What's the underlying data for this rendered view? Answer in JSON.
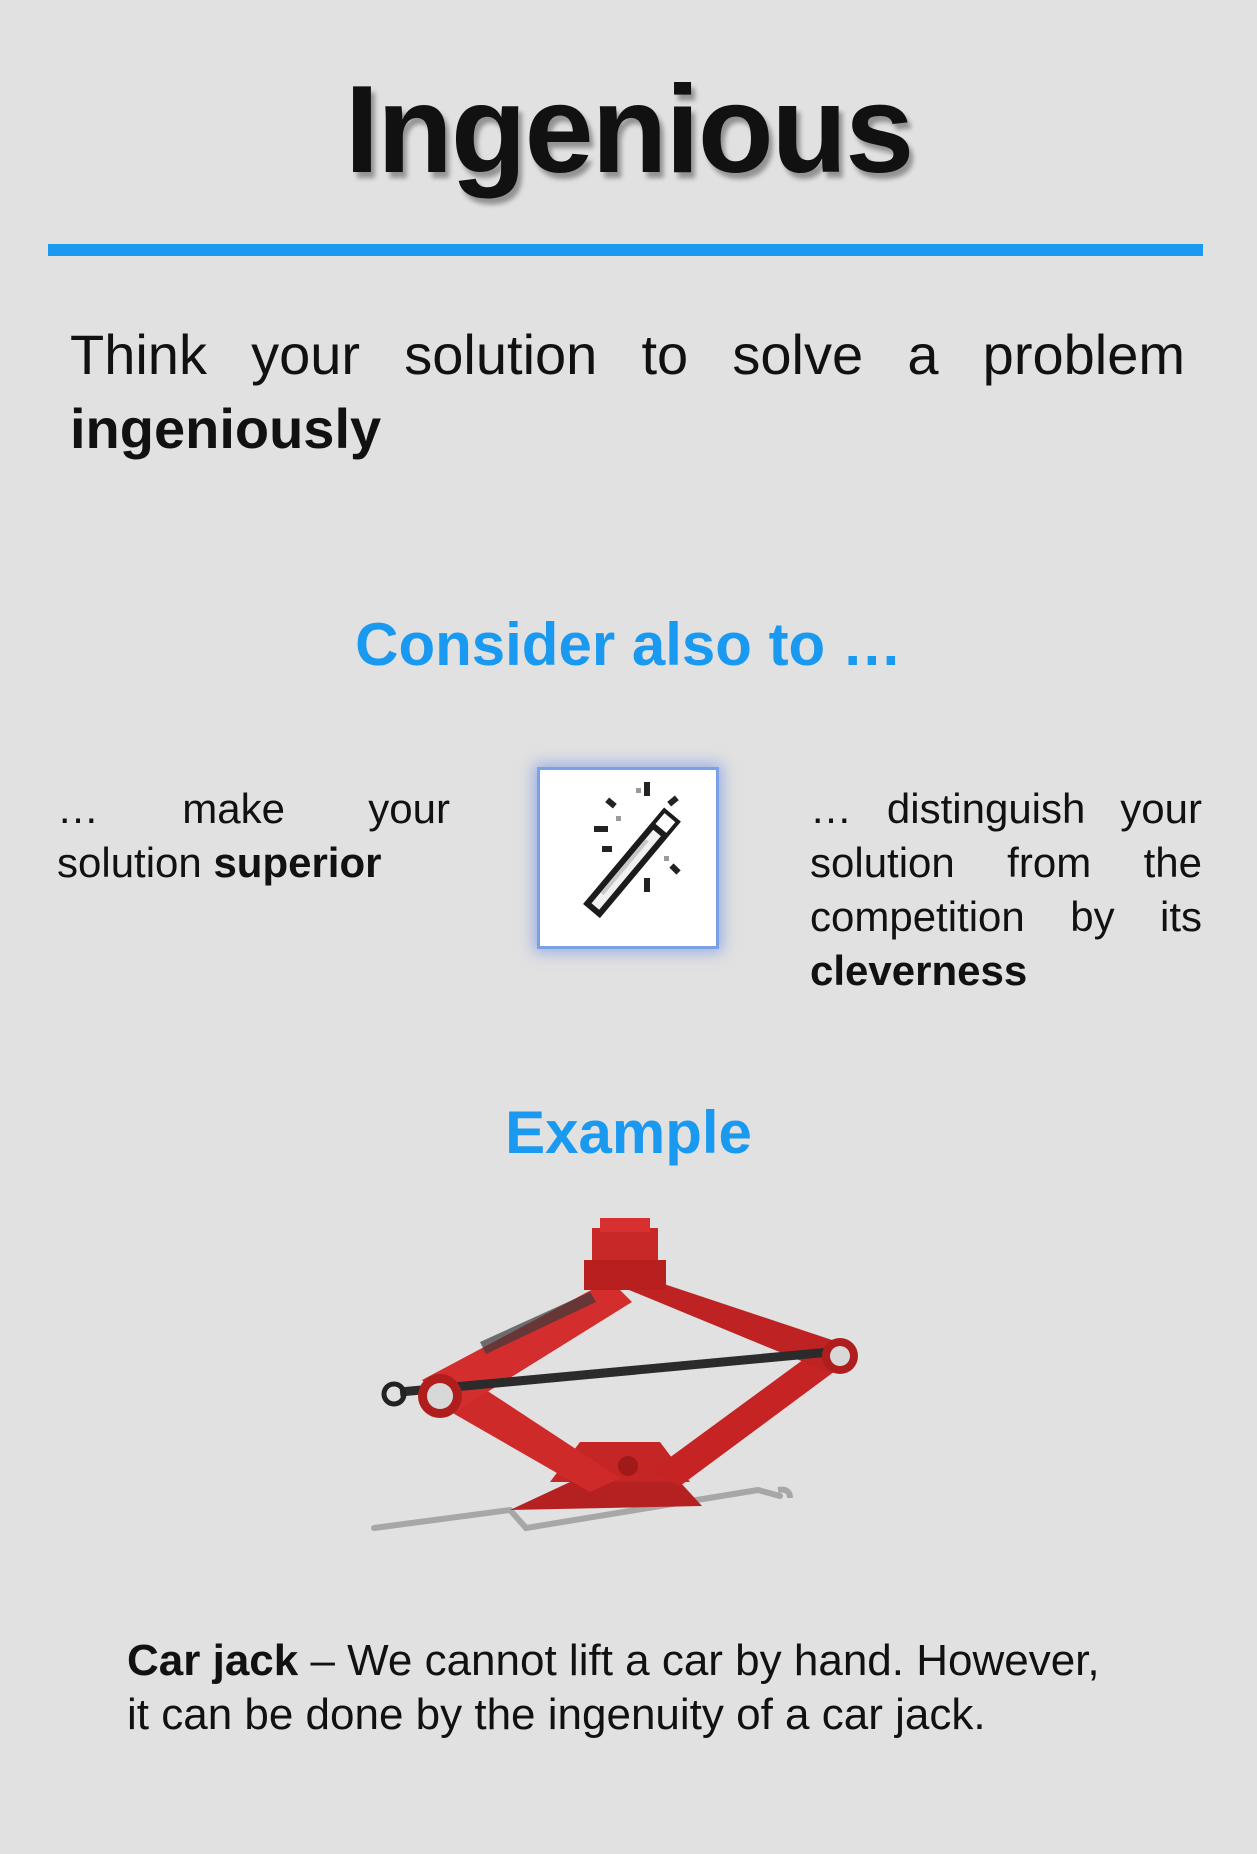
{
  "title": "Ingenious",
  "intro": {
    "line1": "Think your solution to solve a problem",
    "line2": "ingeniously"
  },
  "consider": {
    "heading": "Consider also to …",
    "left": {
      "line1": "… make your",
      "prefix": "solution ",
      "bold": "superior"
    },
    "right": {
      "line1": "… distinguish your",
      "line2": "solution from the",
      "line3": "competition by its",
      "bold": "cleverness"
    },
    "icon": "magic-wand-icon"
  },
  "example": {
    "heading": "Example",
    "image": "car-jack-image",
    "caption_bold": "Car jack",
    "caption_line1": " – We cannot lift a car by hand. However,",
    "caption_line2": "it can be done by the ingenuity of a car jack."
  },
  "colors": {
    "accent": "#1a99f0",
    "background": "#e1e1e1",
    "jack_red": "#d42a2a"
  }
}
